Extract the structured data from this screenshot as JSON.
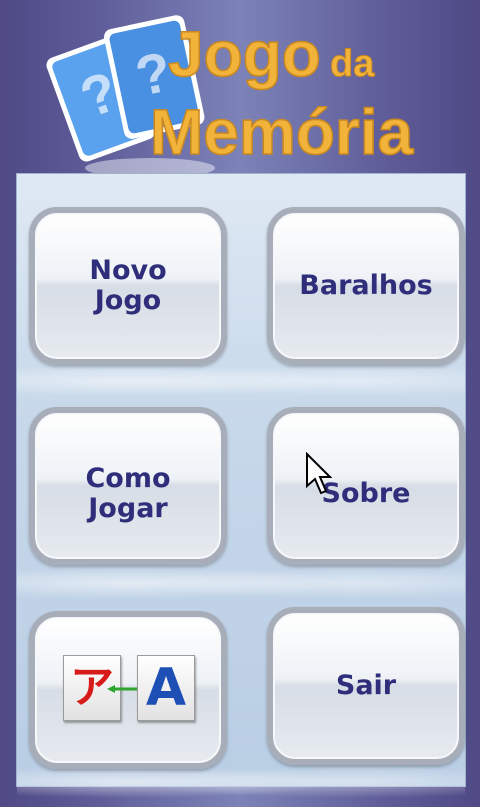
{
  "header": {
    "title_line1": "Jogo",
    "title_da": "da",
    "title_line2": "Memória",
    "card_glyph": "?"
  },
  "menu": {
    "new_game": "Novo\nJogo",
    "decks": "Baralhos",
    "how_to_play": "Como\nJogar",
    "about": "Sobre",
    "language_left": "ア",
    "language_right": "A",
    "exit": "Sair"
  },
  "colors": {
    "title": "#f2b33a",
    "button_text": "#2f2e7a",
    "card_blue": "#4a90e2"
  }
}
